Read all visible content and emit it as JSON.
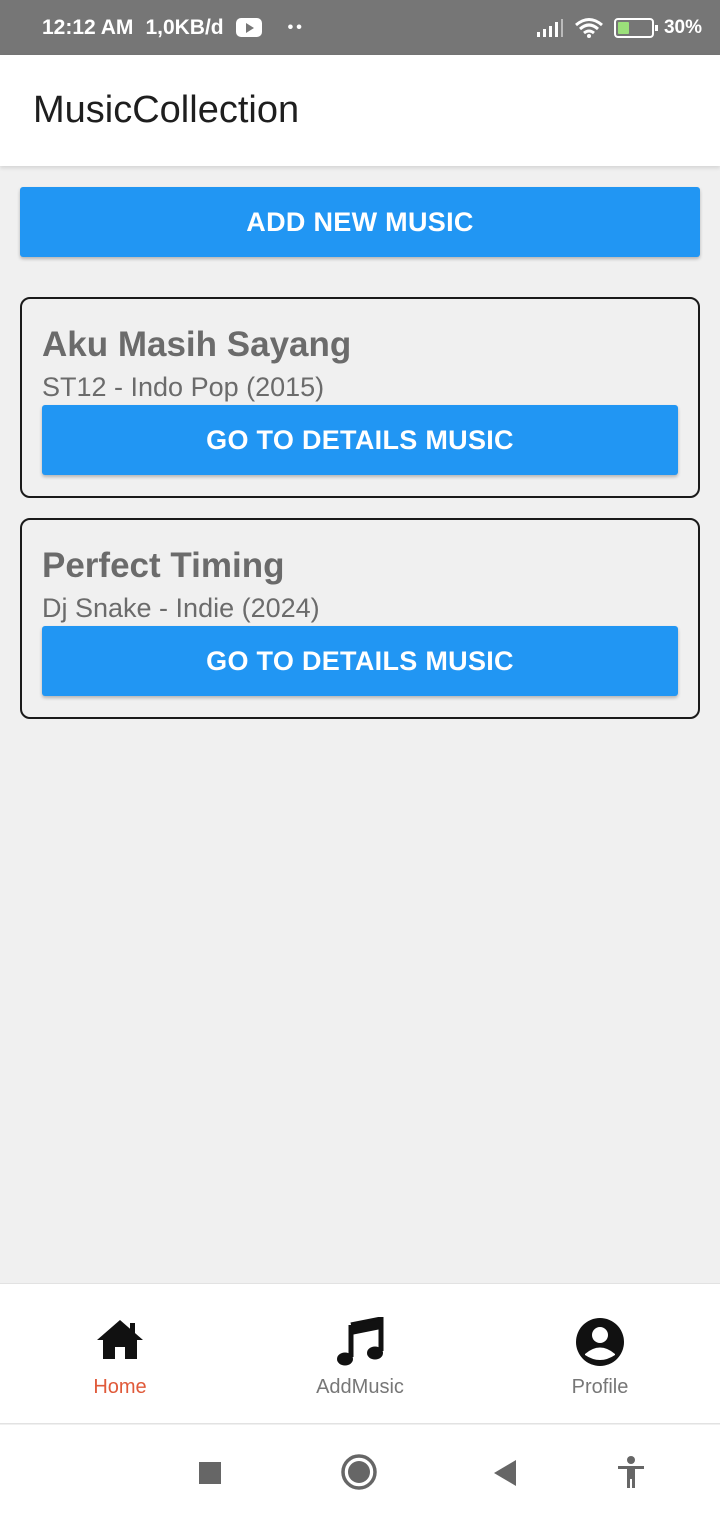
{
  "status_bar": {
    "time": "12:12 AM",
    "data_rate": "1,0KB/d",
    "battery": "30%",
    "icons": [
      "youtube-icon",
      "signal-icon",
      "wifi-icon",
      "battery-charging-icon"
    ]
  },
  "app_bar": {
    "title": "MusicCollection"
  },
  "add_button_label": "ADD NEW MUSIC",
  "music_list": [
    {
      "title": "Aku Masih Sayang",
      "subtitle": "ST12 - Indo Pop (2015)",
      "button_label": "GO TO DETAILS MUSIC"
    },
    {
      "title": "Perfect Timing",
      "subtitle": "Dj Snake - Indie (2024)",
      "button_label": "GO TO DETAILS MUSIC"
    }
  ],
  "bottom_nav": {
    "items": [
      {
        "label": "Home",
        "icon": "home-icon",
        "active": true
      },
      {
        "label": "AddMusic",
        "icon": "music-note-icon",
        "active": false
      },
      {
        "label": "Profile",
        "icon": "account-circle-icon",
        "active": false
      }
    ]
  },
  "system_nav": {
    "icons": [
      "recents-icon",
      "home-circle-icon",
      "back-icon",
      "accessibility-icon"
    ]
  },
  "colors": {
    "accent": "#2196f3",
    "active_tab": "#e05a3a",
    "status_bar": "#767676",
    "background": "#f0f0f0"
  }
}
